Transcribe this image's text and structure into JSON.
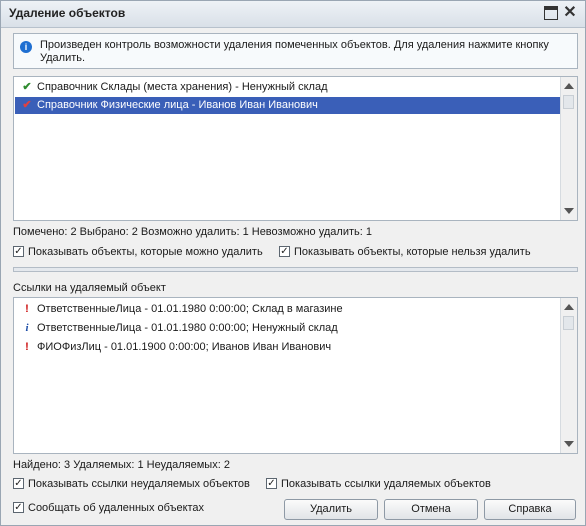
{
  "window": {
    "title": "Удаление объектов"
  },
  "info": {
    "text": "Произведен контроль возможности удаления помеченных объектов. Для удаления нажмите кнопку Удалить."
  },
  "objects_list": {
    "items": [
      {
        "icon": "check-icon",
        "label": "Справочник Склады (места хранения) - Ненужный склад",
        "selected": false
      },
      {
        "icon": "check-icon",
        "label": "Справочник Физические лица - Иванов Иван Иванович",
        "selected": true
      }
    ]
  },
  "objects_status": "Помечено: 2  Выбрано: 2  Возможно удалить: 1  Невозможно удалить: 1",
  "objects_filters": {
    "show_deletable": {
      "label": "Показывать объекты, которые можно удалить",
      "checked": true
    },
    "show_undeletable": {
      "label": "Показывать объекты, которые нельзя удалить",
      "checked": true
    }
  },
  "references": {
    "caption": "Ссылки на удаляемый объект",
    "items": [
      {
        "icon": "exclamation-icon",
        "label": "ОтветственныеЛица  - 01.01.1980 0:00:00; Склад в магазине"
      },
      {
        "icon": "info-icon",
        "label": "ОтветственныеЛица  - 01.01.1980 0:00:00; Ненужный склад"
      },
      {
        "icon": "exclamation-icon",
        "label": "ФИОФизЛиц  - 01.01.1900 0:00:00; Иванов Иван Иванович"
      }
    ]
  },
  "references_status": "Найдено: 3  Удаляемых: 1  Неудаляемых: 2",
  "references_filters": {
    "show_undeletable_refs": {
      "label": "Показывать ссылки неудаляемых объектов",
      "checked": true
    },
    "show_deletable_refs": {
      "label": "Показывать ссылки удаляемых объектов",
      "checked": true
    }
  },
  "report_deleted": {
    "label": "Сообщать об удаленных объектах",
    "checked": true
  },
  "buttons": {
    "delete": "Удалить",
    "cancel": "Отмена",
    "help": "Справка"
  },
  "colors": {
    "selection": "#3a5fb8",
    "check": "#2e8b2e",
    "exclamation": "#cc1111",
    "info": "#1f4fa8"
  }
}
